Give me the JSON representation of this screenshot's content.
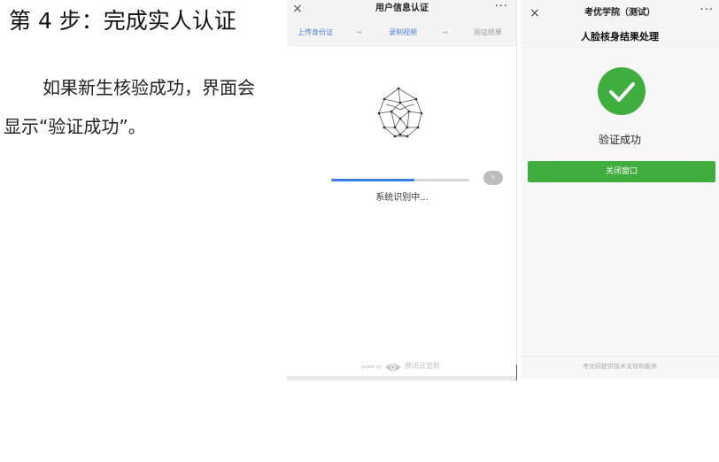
{
  "document": {
    "title": "第 4 步：完成实人认证",
    "paragraph_line1": "如果新生核验成功，界面会",
    "paragraph_line2": "显示“验证成功”。"
  },
  "screen1": {
    "close_icon": "×",
    "title": "用户信息认证",
    "more_icon": "···",
    "steps": [
      {
        "label": "上传身份证",
        "state": "done"
      },
      {
        "label": "录制视频",
        "state": "active"
      },
      {
        "label": "验证结果",
        "state": "pending"
      }
    ],
    "step_arrow": "→",
    "progress_fraction": 0.6,
    "next_button_glyph": "›",
    "status_text": "系统识别中...",
    "powered_by": "power by",
    "brand": "腾讯云慧眼",
    "colors": {
      "accent": "#3f7de0",
      "step_active": "#4a7fd4"
    }
  },
  "screen2": {
    "close_icon": "×",
    "title": "考优学院（测试）",
    "more_icon": "···",
    "subtitle": "人脸核身结果处理",
    "success_text": "验证成功",
    "close_button": "关闭窗口",
    "footer": "考优网提供技术支持和服务",
    "colors": {
      "success": "#3fae3f"
    }
  }
}
